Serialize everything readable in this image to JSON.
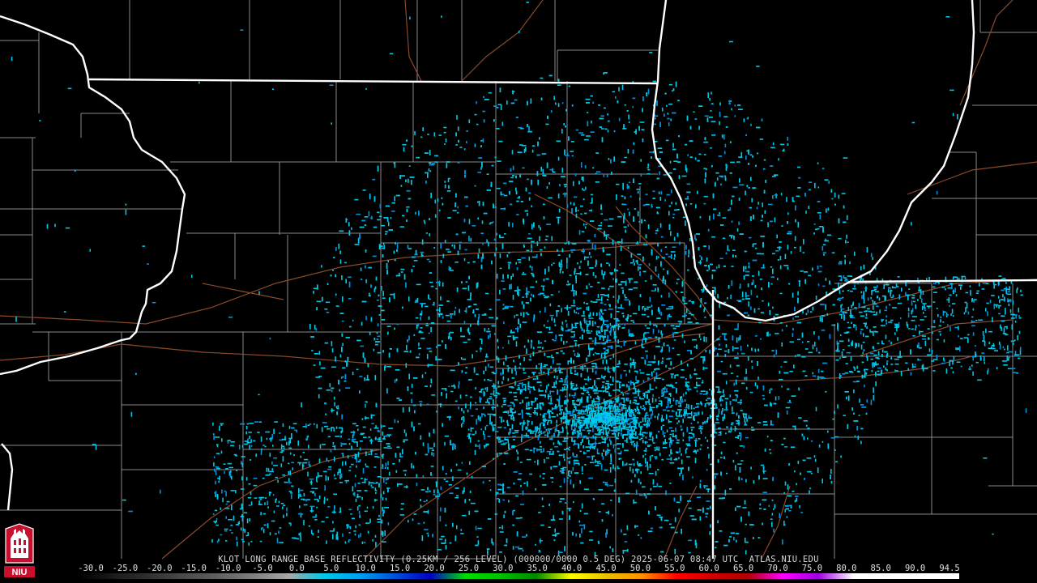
{
  "caption": "KLOT LONG RANGE BASE REFLECTIVITY (0.25KM / 256 LEVEL) (000000/0000 0.5 DEG) 2025-06-07 08:47 UTC  ATLAS.NIU.EDU",
  "scale_labels": [
    "-30.0",
    "-25.0",
    "-20.0",
    "-15.0",
    "-10.0",
    "-5.0",
    "0.0",
    "5.0",
    "10.0",
    "15.0",
    "20.0",
    "25.0",
    "30.0",
    "35.0",
    "40.0",
    "45.0",
    "50.0",
    "55.0",
    "60.0",
    "65.0",
    "70.0",
    "75.0",
    "80.0",
    "85.0",
    "90.0",
    "94.5"
  ],
  "logo_text": "NIU",
  "colors": {
    "state_border": "#ffffff",
    "county_line": "#8a8a8a",
    "highway": "#8b4a2a",
    "echo_primary": "#00c8e8",
    "echo_secondary": "#0090e0",
    "logo_red": "#c8102e"
  },
  "colorbar_stops": [
    "#000000",
    "#1a1a1a",
    "#303030",
    "#4a4a4a",
    "#606060",
    "#808080",
    "#a8a8a8",
    "#00c8e8",
    "#00a0f0",
    "#0050d8",
    "#0000c8",
    "#00e000",
    "#00c000",
    "#008800",
    "#ffff00",
    "#e8c000",
    "#ff9000",
    "#ff0000",
    "#d00000",
    "#b00000",
    "#ff00ff",
    "#a000e0",
    "#ffffff",
    "#ffffff",
    "#ffffff",
    "#ffffff"
  ]
}
